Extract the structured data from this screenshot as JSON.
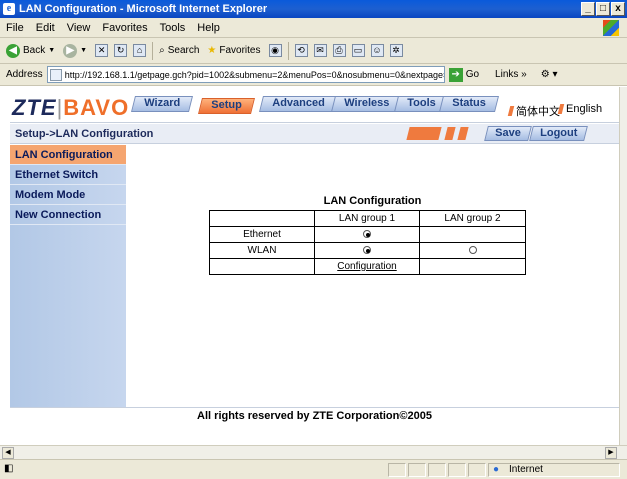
{
  "window": {
    "title": "LAN Configuration - Microsoft Internet Explorer"
  },
  "menu": [
    "File",
    "Edit",
    "View",
    "Favorites",
    "Tools",
    "Help"
  ],
  "toolbar": {
    "back": "Back",
    "search": "Search",
    "favorites": "Favorites"
  },
  "address": {
    "label": "Address",
    "url": "http://192.168.1.1/getpage.gch?pid=1002&submenu=2&menuPos=0&nosubmenu=0&nextpage=setup/lar",
    "go": "Go",
    "links": "Links"
  },
  "logo": {
    "zte": "ZTE",
    "separator": "|",
    "bavo": "BAVO"
  },
  "nav": [
    "Wizard",
    "Setup",
    "Advanced",
    "Wireless",
    "Tools",
    "Status"
  ],
  "languages": [
    "简体中文",
    "English"
  ],
  "breadcrumb": "Setup->LAN Configuration",
  "actions": {
    "save": "Save",
    "logout": "Logout"
  },
  "sidebar": [
    "LAN Configuration",
    "Ethernet Switch",
    "Modem Mode",
    "New Connection"
  ],
  "panel": {
    "title": "LAN Configuration",
    "headers": [
      "",
      "LAN group 1",
      "LAN group 2"
    ],
    "rows": [
      {
        "label": "Ethernet",
        "group1": true,
        "group2": null
      },
      {
        "label": "WLAN",
        "group1": true,
        "group2": false
      }
    ],
    "config_link": "Configuration"
  },
  "footer": "All rights reserved by ZTE Corporation©2005",
  "status": {
    "zone": "Internet"
  },
  "colors": {
    "accent": "#ef7a3e",
    "nav_blue": "#1d3f7f",
    "sidebar": "#b2c8e6",
    "title_bar": "#0a5adb"
  }
}
